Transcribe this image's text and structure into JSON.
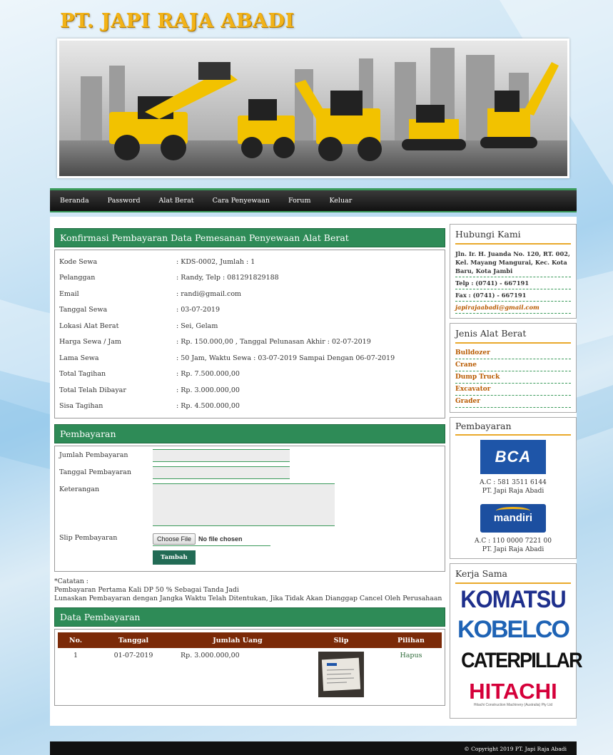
{
  "site": {
    "title": "PT. JAPI RAJA ABADI"
  },
  "nav": [
    "Beranda",
    "Password",
    "Alat Berat",
    "Cara Penyewaan",
    "Forum",
    "Keluar"
  ],
  "konfirmasi": {
    "title": "Konfirmasi Pembayaran Data Pemesanan Penyewaan Alat Berat",
    "rows": [
      {
        "label": "Kode Sewa",
        "value": ": KDS-0002, Jumlah : 1"
      },
      {
        "label": "Pelanggan",
        "value": ": Randy, Telp : 081291829188"
      },
      {
        "label": "Email",
        "value": ": randi@gmail.com"
      },
      {
        "label": "Tanggal Sewa",
        "value": ": 03-07-2019"
      },
      {
        "label": "Lokasi Alat Berat",
        "value": ": Sei, Gelam"
      },
      {
        "label": "Harga Sewa / Jam",
        "value": ": Rp. 150.000,00 , Tanggal Pelunasan Akhir : 02-07-2019"
      },
      {
        "label": "Lama Sewa",
        "value": ": 50 Jam, Waktu Sewa : 03-07-2019 Sampai Dengan 06-07-2019"
      },
      {
        "label": "Total Tagihan",
        "value": ": Rp. 7.500.000,00"
      },
      {
        "label": "Total Telah Dibayar",
        "value": ": Rp. 3.000.000,00"
      },
      {
        "label": "Sisa Tagihan",
        "value": ": Rp. 4.500.000,00"
      }
    ]
  },
  "pembayaran_form": {
    "title": "Pembayaran",
    "jumlah_label": "Jumlah Pembayaran",
    "tanggal_label": "Tanggal Pembayaran",
    "keterangan_label": "Keterangan",
    "slip_label": "Slip Pembayaran",
    "file_button": "Choose File",
    "file_status": "No file chosen",
    "submit": "Tambah"
  },
  "catatan": {
    "heading": "*Catatan :",
    "line1": "Pembayaran Pertama Kali DP 50 % Sebagai Tanda Jadi",
    "line2": "Lunaskan Pembayaran dengan Jangka Waktu Telah Ditentukan, Jika Tidak Akan Dianggap Cancel Oleh Perusahaan"
  },
  "data_pembayaran": {
    "title": "Data Pembayaran",
    "headers": [
      "No.",
      "Tanggal",
      "Jumlah Uang",
      "Slip",
      "Pilihan"
    ],
    "rows": [
      {
        "no": "1",
        "tanggal": "01-07-2019",
        "jumlah": "Rp. 3.000.000,00",
        "pilihan": "Hapus"
      }
    ]
  },
  "sidebar": {
    "hubungi": {
      "title": "Hubungi Kami",
      "address": "Jln. Ir. H. Juanda No. 120, RT. 002, Kel. Mayang Mangurai, Kec. Kota Baru, Kota Jambi",
      "telp": "Telp : (0741) - 667191",
      "fax": "Fax : (0741) - 667191",
      "email": "japirajaabadi@gmail.com"
    },
    "jenis": {
      "title": "Jenis Alat Berat",
      "items": [
        "Bulldozer",
        "Crane",
        "Dump Truck",
        "Excavator",
        "Grader"
      ]
    },
    "pembayaran": {
      "title": "Pembayaran",
      "bca_logo": "BCA",
      "bca_ac": "A.C : 581 3511 6144",
      "bca_name": "PT. Japi Raja Abadi",
      "mandiri_logo": "mandiri",
      "mandiri_ac": "A.C : 110 0000 7221 00",
      "mandiri_name": "PT. Japi Raja Abadi"
    },
    "kerjasama": {
      "title": "Kerja Sama",
      "partners": [
        "KOMATSU",
        "KOBELCO",
        "CATERPILLAR",
        "HITACHI"
      ],
      "hitachi_sub": "Hitachi Construction Machinery (Australia) Pty Ltd"
    }
  },
  "footer": "© Copyright 2019 PT. Japi Raja Abadi",
  "colors": {
    "green": "#2e8b57",
    "brown": "#7b2a08",
    "gold": "#f2b318",
    "orange_text": "#b85a00"
  }
}
